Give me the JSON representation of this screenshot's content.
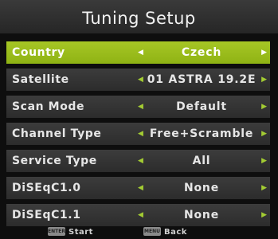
{
  "title": "Tuning Setup",
  "rows": [
    {
      "label": "Country",
      "value": "Czech"
    },
    {
      "label": "Satellite",
      "value": "01 ASTRA 19.2E"
    },
    {
      "label": "Scan Mode",
      "value": "Default"
    },
    {
      "label": "Channel Type",
      "value": "Free+Scramble"
    },
    {
      "label": "Service Type",
      "value": "All"
    },
    {
      "label": "DiSEqC1.0",
      "value": "None"
    },
    {
      "label": "DiSEqC1.1",
      "value": "None"
    }
  ],
  "arrows": {
    "left": "◀",
    "right": "▶"
  },
  "footer": {
    "start_key": "ENTER",
    "start_label": "Start",
    "back_key": "MENU",
    "back_label": "Back"
  },
  "colors": {
    "highlight": "#9cbe1c",
    "row_bg": "#333333",
    "title_bg": "#2e2e2e"
  }
}
